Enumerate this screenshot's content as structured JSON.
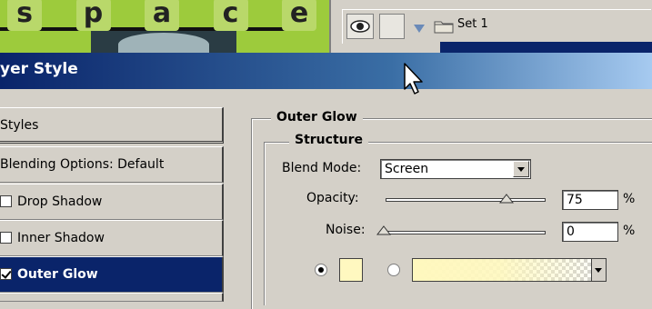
{
  "artwork": {
    "letters": [
      "s",
      "p",
      "a",
      "c",
      "e"
    ]
  },
  "layers": {
    "set_label": "Set 1"
  },
  "dialog": {
    "title": "yer Style"
  },
  "left_panel": {
    "styles_label": "Styles",
    "blending_label": "Blending Options: Default",
    "items": [
      {
        "label": "Drop Shadow",
        "checked": false
      },
      {
        "label": "Inner Shadow",
        "checked": false
      },
      {
        "label": "Outer Glow",
        "checked": true,
        "selected": true
      }
    ]
  },
  "outer_glow": {
    "title": "Outer Glow",
    "structure_title": "Structure",
    "blend_mode_label": "Blend Mode:",
    "blend_mode_value": "Screen",
    "opacity_label": "Opacity:",
    "opacity_value": "75",
    "noise_label": "Noise:",
    "noise_value": "0",
    "percent": "%",
    "color_choice": "solid",
    "glow_color": "#fff8c0"
  },
  "colors": {
    "selection": "#0a246a",
    "panel_bg": "#d4d0c8",
    "title_gradient_start": "#0a246a",
    "title_gradient_end": "#a6caf0",
    "artwork_bg": "#9dcb3c"
  },
  "icons": [
    "eye-icon",
    "folder-icon",
    "triangle-icon",
    "mouse-cursor-icon",
    "chevron-down-icon"
  ]
}
